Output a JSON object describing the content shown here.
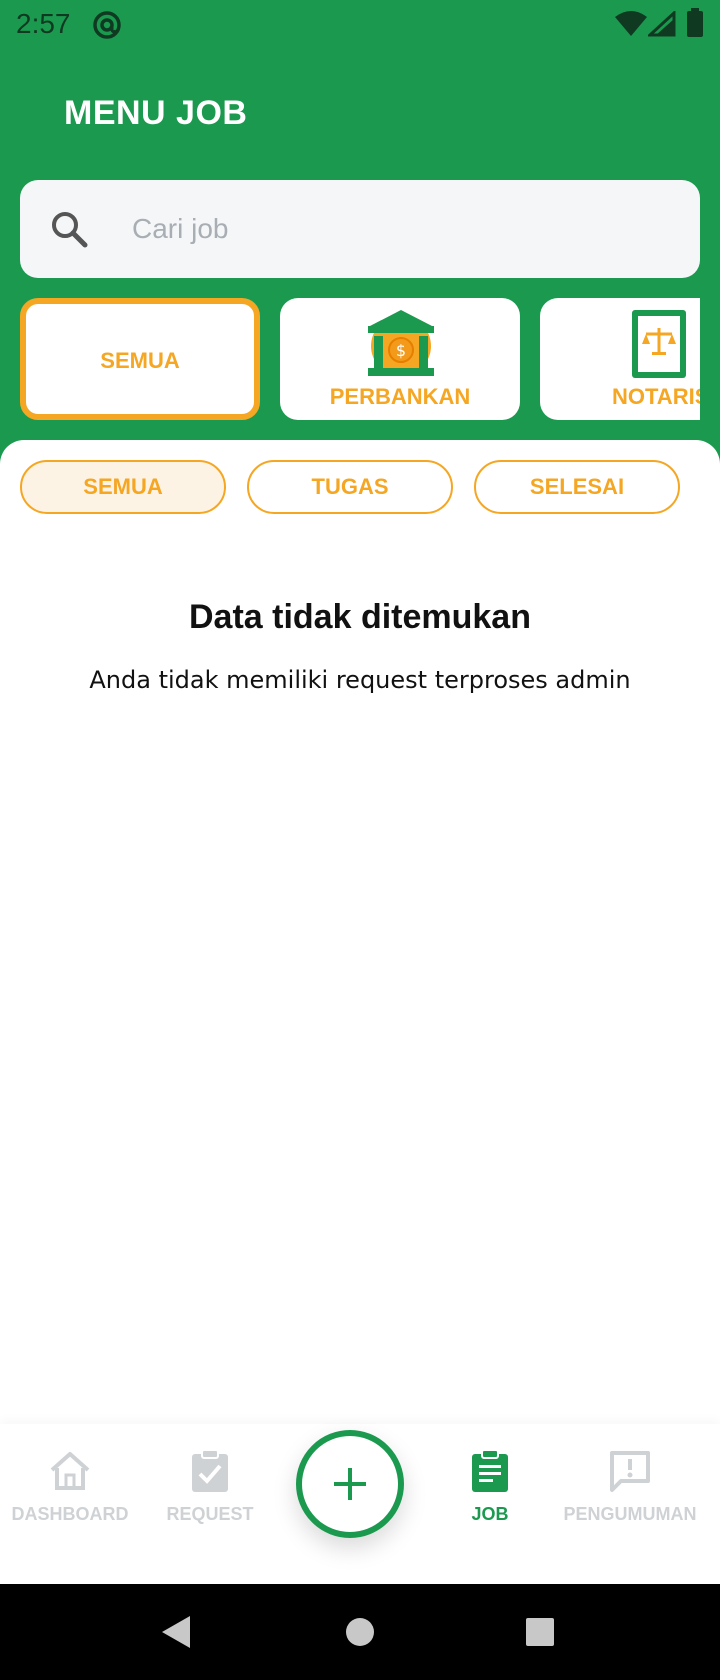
{
  "status_bar": {
    "time": "2:57",
    "icons": [
      "at-icon",
      "wifi-icon",
      "signal-icon",
      "battery-icon"
    ]
  },
  "header": {
    "title": "MENU JOB"
  },
  "search": {
    "placeholder": "Cari job",
    "value": ""
  },
  "categories": [
    {
      "label": "SEMUA",
      "icon": "",
      "selected": true
    },
    {
      "label": "PERBANKAN",
      "icon": "bank-icon",
      "selected": false
    },
    {
      "label": "NOTARIS",
      "icon": "notary-scale-icon",
      "selected": false
    }
  ],
  "filters": [
    {
      "label": "SEMUA",
      "selected": true
    },
    {
      "label": "TUGAS",
      "selected": false
    },
    {
      "label": "SELESAI",
      "selected": false
    }
  ],
  "empty_state": {
    "title": "Data tidak ditemukan",
    "subtitle": "Anda tidak memiliki request terproses admin"
  },
  "bottom_nav": {
    "items": [
      {
        "label": "DASHBOARD",
        "icon": "home-icon",
        "active": false
      },
      {
        "label": "REQUEST",
        "icon": "clipboard-check-icon",
        "active": false
      },
      {
        "label": "JOB",
        "icon": "clipboard-list-icon",
        "active": true
      },
      {
        "label": "PENGUMUMAN",
        "icon": "announcement-icon",
        "active": false
      }
    ],
    "fab_icon": "plus-icon"
  },
  "colors": {
    "primary_green": "#1b9a4f",
    "accent_orange": "#f5a623",
    "inactive_grey": "#cfd2d5"
  }
}
